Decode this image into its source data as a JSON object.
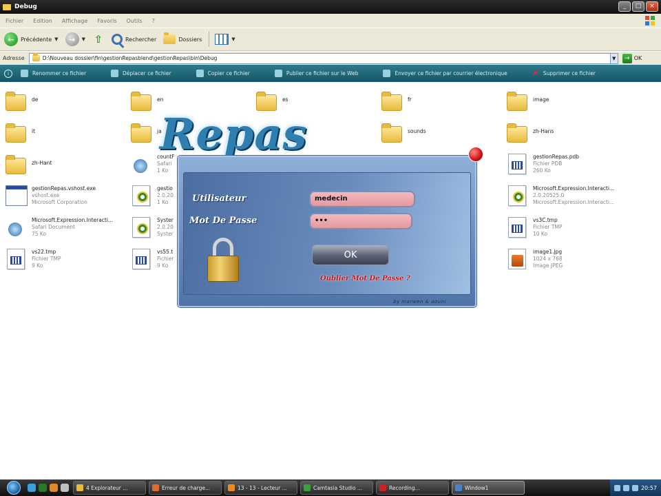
{
  "window": {
    "title": "Debug"
  },
  "menu": [
    "Fichier",
    "Edition",
    "Affichage",
    "Favoris",
    "Outils",
    "?"
  ],
  "toolbar": {
    "back_label": "Précédente",
    "search_label": "Rechercher",
    "folders_label": "Dossiers"
  },
  "address": {
    "label": "Adresse",
    "path": "D:\\Nouveau dossier\\fin\\gestionRepasblend\\gestionRepas\\bin\\Debug",
    "go_label": "OK"
  },
  "file_tasks": [
    "Renommer ce fichier",
    "Déplacer ce fichier",
    "Copier ce fichier",
    "Publier ce fichier sur le Web",
    "Envoyer ce fichier par courrier électronique",
    "Supprimer ce fichier"
  ],
  "folders": [
    "de",
    "en",
    "es",
    "fr",
    "image",
    "it",
    "ja",
    "sounds",
    "zh-Hans",
    "zh-Hant"
  ],
  "files": [
    {
      "name": "countF",
      "sub1": "Safari",
      "sub2": "1 Ko",
      "icon": "safari-icon"
    },
    {
      "name": "gestionRepas.pdb",
      "sub1": "Fichier PDB",
      "sub2": "260 Ko",
      "icon": "document-icon"
    },
    {
      "name": "gestionRepas.vshost.exe",
      "sub1": "vshost.exe",
      "sub2": "Microsoft Corporation",
      "icon": "exe-icon"
    },
    {
      "name": "gestio",
      "sub1": "2.0.20",
      "sub2": "1 Ko",
      "icon": "assembly-icon"
    },
    {
      "name": "Microsoft.Expression.Interacti...",
      "sub1": "2.0.20525.0",
      "sub2": "Microsoft.Expression.Interacti...",
      "icon": "assembly-icon"
    },
    {
      "name": "Microsoft.Expression.Interacti...",
      "sub1": "Safari Document",
      "sub2": "75 Ko",
      "icon": "safari-icon"
    },
    {
      "name": "Syster",
      "sub1": "2.0.20",
      "sub2": "Syster",
      "icon": "assembly-icon"
    },
    {
      "name": "vs3C.tmp",
      "sub1": "Fichier TMP",
      "sub2": "10 Ko",
      "icon": "document-icon"
    },
    {
      "name": "vs22.tmp",
      "sub1": "Fichier TMP",
      "sub2": "9 Ko",
      "icon": "document-icon"
    },
    {
      "name": "vs55.t",
      "sub1": "Fichier",
      "sub2": "9 Ko",
      "icon": "document-icon"
    },
    {
      "name": "image1.jpg",
      "sub1": "1024 x 768",
      "sub2": "Image JPEG",
      "icon": "jpeg-icon"
    }
  ],
  "login": {
    "app_title": "Repas",
    "user_label": "Utilisateur",
    "password_label": "Mot De Passe",
    "user_value": "medecin",
    "password_value": "•••",
    "ok_label": "OK",
    "forgot_label": "Oublier Mot De Passe ?",
    "signature": "by marwen & aouni"
  },
  "taskbar": {
    "items": [
      "4 Explorateur ...",
      "Erreur de charge...",
      "13 - 13 - Lecteur ...",
      "Camtasia Studio ...",
      "Recording...",
      "Window1"
    ],
    "clock": "20:57"
  }
}
